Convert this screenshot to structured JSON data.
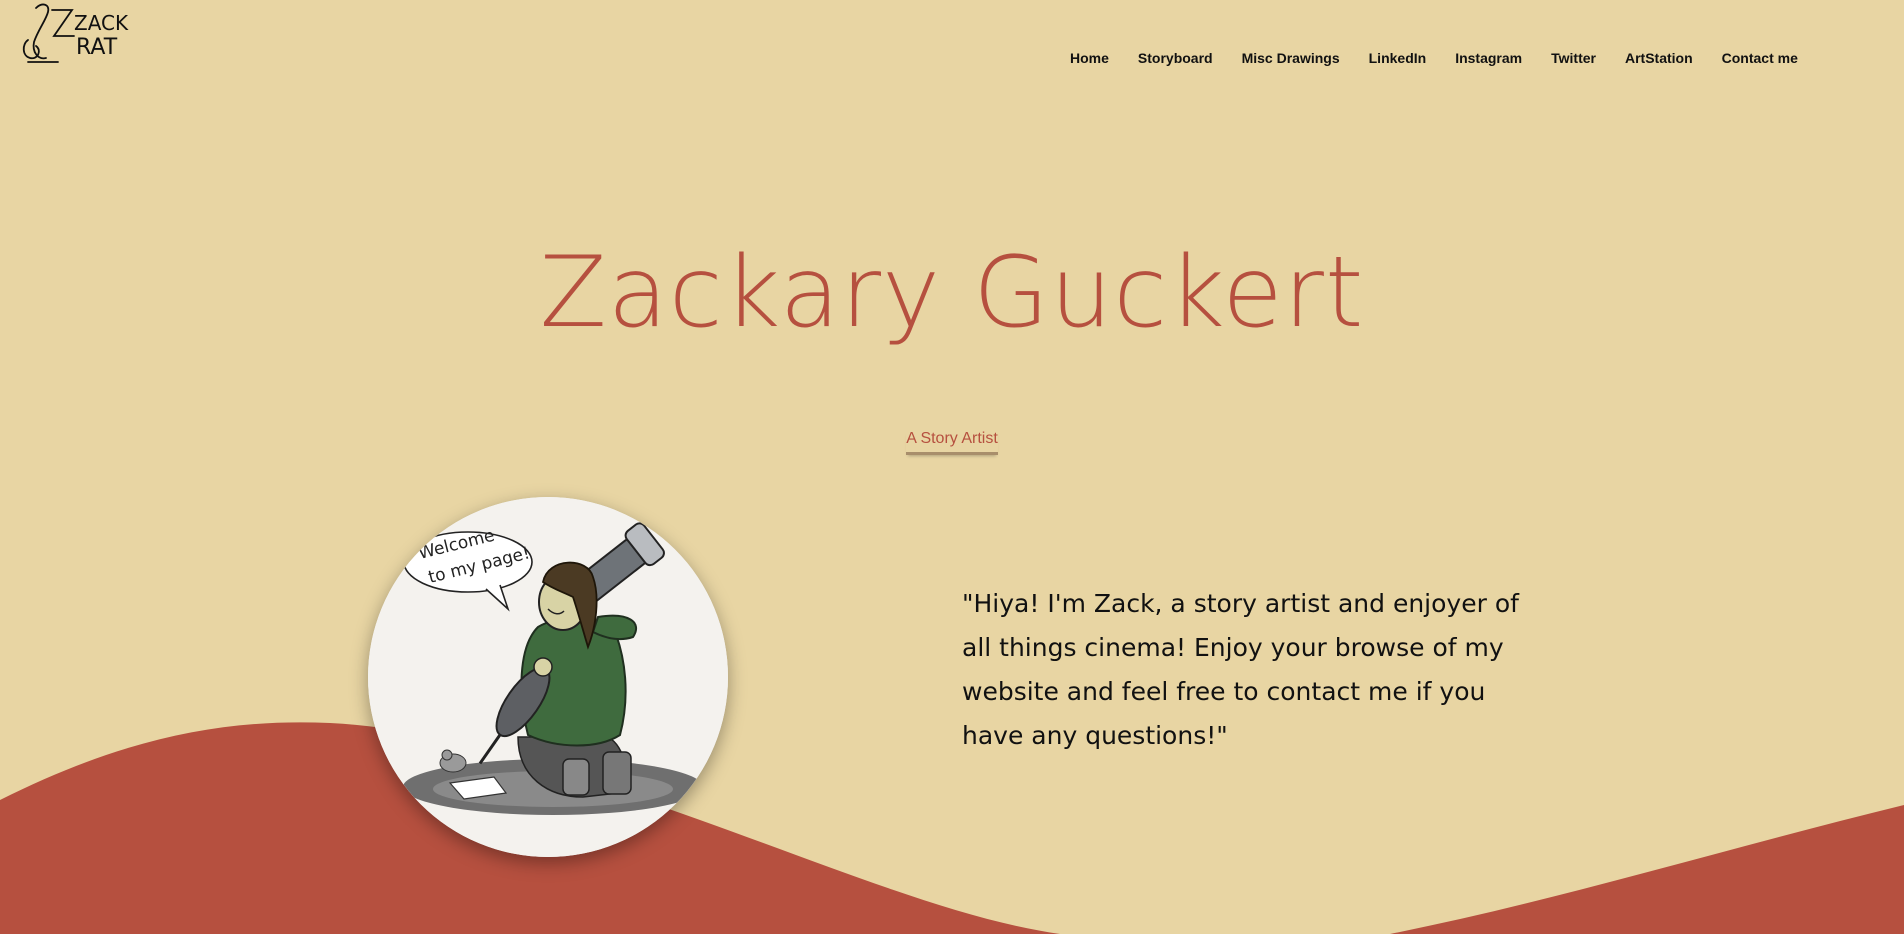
{
  "logo": {
    "text_line1": "ZACK",
    "text_line2": "RAT",
    "icon": "zack-rat-logo"
  },
  "nav": {
    "items": [
      {
        "label": "Home"
      },
      {
        "label": "Storyboard"
      },
      {
        "label": "Misc Drawings"
      },
      {
        "label": "LinkedIn"
      },
      {
        "label": "Instagram"
      },
      {
        "label": "Twitter"
      },
      {
        "label": "ArtStation"
      },
      {
        "label": "Contact me"
      }
    ]
  },
  "hero": {
    "title": "Zackary Guckert",
    "subtitle": "A Story Artist"
  },
  "avatar": {
    "speech_line1": "Welcome",
    "speech_line2": "to my page!"
  },
  "intro": {
    "quote": "\"Hiya! I'm Zack, a story artist and enjoyer of all things cinema! Enjoy your browse of my website and feel free to contact me if you have any questions!\""
  },
  "colors": {
    "background": "#e8d5a3",
    "accent": "#b6503f",
    "nav_text": "#111111"
  }
}
